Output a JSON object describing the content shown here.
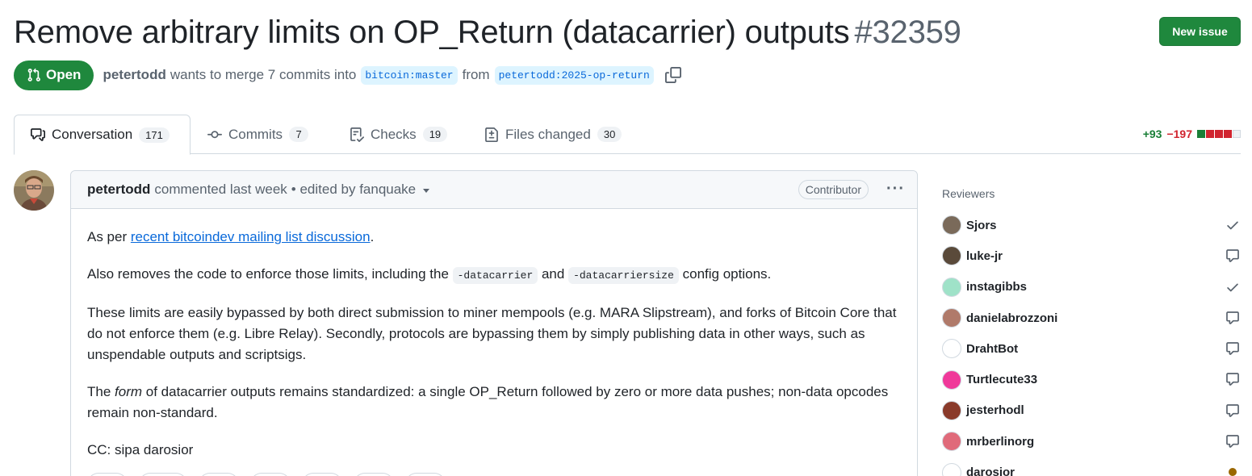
{
  "header": {
    "title": "Remove arbitrary limits on OP_Return (datacarrier) outputs",
    "number": "#32359",
    "new_issue_label": "New issue"
  },
  "meta": {
    "state": "Open",
    "author": "petertodd",
    "merge_text": "wants to merge 7 commits into",
    "base_branch": "bitcoin:master",
    "from_text": "from",
    "head_branch": "petertodd:2025-op-return"
  },
  "tabs": [
    {
      "label": "Conversation",
      "count": "171"
    },
    {
      "label": "Commits",
      "count": "7"
    },
    {
      "label": "Checks",
      "count": "19"
    },
    {
      "label": "Files changed",
      "count": "30"
    }
  ],
  "diffstat": {
    "additions": "+93",
    "deletions": "−197",
    "colors": {
      "add": "#1a7f37",
      "del": "#d1242f",
      "neutral": "#d1d9e0"
    }
  },
  "comment": {
    "author": "petertodd",
    "action": "commented last week",
    "edited": "• edited by fanquake",
    "badge": "Contributor",
    "p1_pre": "As per ",
    "p1_link": "recent bitcoindev mailing list discussion",
    "p1_post": ".",
    "p2_pre": "Also removes the code to enforce those limits, including the ",
    "p2_code1": "-datacarrier",
    "p2_mid": " and ",
    "p2_code2": "-datacarriersize",
    "p2_post": " config options.",
    "p3": "These limits are easily bypassed by both direct submission to miner mempools (e.g. MARA Slipstream), and forks of Bitcoin Core that do not enforce them (e.g. Libre Relay). Secondly, protocols are bypassing them by simply publishing data in other ways, such as unspendable outputs and scriptsigs.",
    "p4_pre": "The ",
    "p4_em": "form",
    "p4_post": " of datacarrier outputs remains standardized: a single OP_Return followed by zero or more data pushes; non-data opcodes remain non-standard.",
    "p5": "CC: sipa darosior"
  },
  "sidebar": {
    "heading": "Reviewers",
    "reviewers": [
      {
        "name": "Sjors",
        "status": "approved"
      },
      {
        "name": "luke-jr",
        "status": "commented"
      },
      {
        "name": "instagibbs",
        "status": "approved"
      },
      {
        "name": "danielabrozzoni",
        "status": "commented"
      },
      {
        "name": "DrahtBot",
        "status": "commented"
      },
      {
        "name": "Turtlecute33",
        "status": "commented"
      },
      {
        "name": "jesterhodl",
        "status": "commented"
      },
      {
        "name": "mrberlinorg",
        "status": "commented"
      },
      {
        "name": "darosior",
        "status": "pending"
      }
    ]
  }
}
